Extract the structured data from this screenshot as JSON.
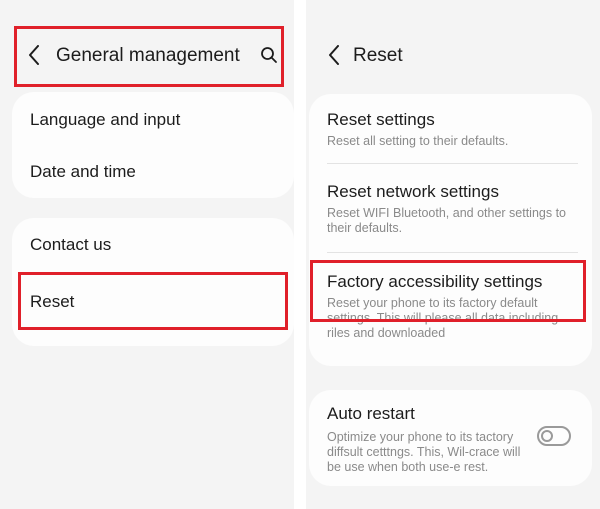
{
  "left": {
    "header": {
      "title": "General management"
    },
    "items": [
      {
        "label": "Language and input"
      },
      {
        "label": "Date and time"
      },
      {
        "label": "Contact us"
      },
      {
        "label": "Reset"
      }
    ]
  },
  "right": {
    "header": {
      "title": "Reset"
    },
    "items": [
      {
        "label": "Reset settings",
        "sub": "Reset all setting to their defaults."
      },
      {
        "label": "Reset network settings",
        "sub": "Reset WIFI Bluetooth, and other settings to their defaults."
      },
      {
        "label": "Factory accessibility settings",
        "sub": "Reset your phone to its factory default settings. This will please all data including riles and downloaded"
      },
      {
        "label": "Auto restart",
        "sub": "Optimize your phone to its tactory diffsult cetttngs. This, Wil-crace will be use when both use-e rest.",
        "toggle_on": false
      }
    ]
  },
  "colors": {
    "highlight": "#e0202a",
    "background": "#f4f4f4",
    "card": "#fdfdfd"
  }
}
